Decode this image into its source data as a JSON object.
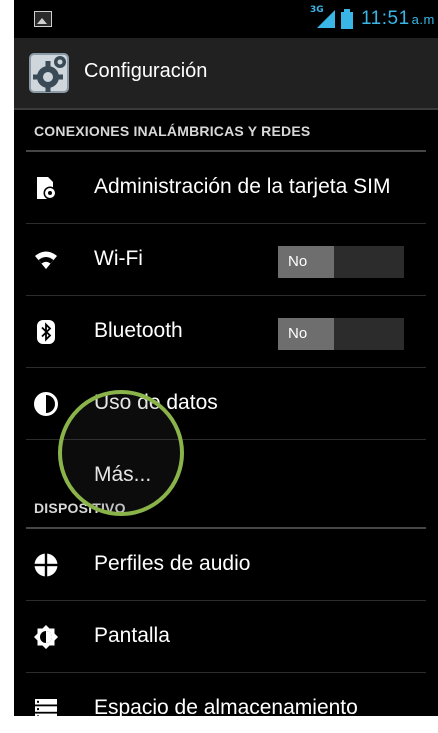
{
  "status_bar": {
    "network_type": "3G",
    "time": "11:51",
    "ampm": "a.m",
    "accent_color": "#39b6e6"
  },
  "action_bar": {
    "title": "Configuración",
    "icon": "settings-gear-icon"
  },
  "sections": {
    "wireless": {
      "label": "CONEXIONES INALÁMBRICAS Y REDES"
    },
    "device": {
      "label": "DISPOSITIVO"
    }
  },
  "items": {
    "sim": {
      "label": "Administración de la tarjeta SIM",
      "icon": "sim-card-icon"
    },
    "wifi": {
      "label": "Wi-Fi",
      "icon": "wifi-icon",
      "toggle": "No"
    },
    "bluetooth": {
      "label": "Bluetooth",
      "icon": "bluetooth-icon",
      "toggle": "No"
    },
    "data_usage": {
      "label": "Uso de datos",
      "icon": "data-usage-icon"
    },
    "more": {
      "label": "Más..."
    },
    "audio_profiles": {
      "label": "Perfiles de audio",
      "icon": "audio-profiles-icon"
    },
    "display": {
      "label": "Pantalla",
      "icon": "brightness-icon"
    },
    "storage": {
      "label": "Espacio de almacenamiento",
      "icon": "storage-icon"
    }
  },
  "highlight_color": "#8ab34a"
}
